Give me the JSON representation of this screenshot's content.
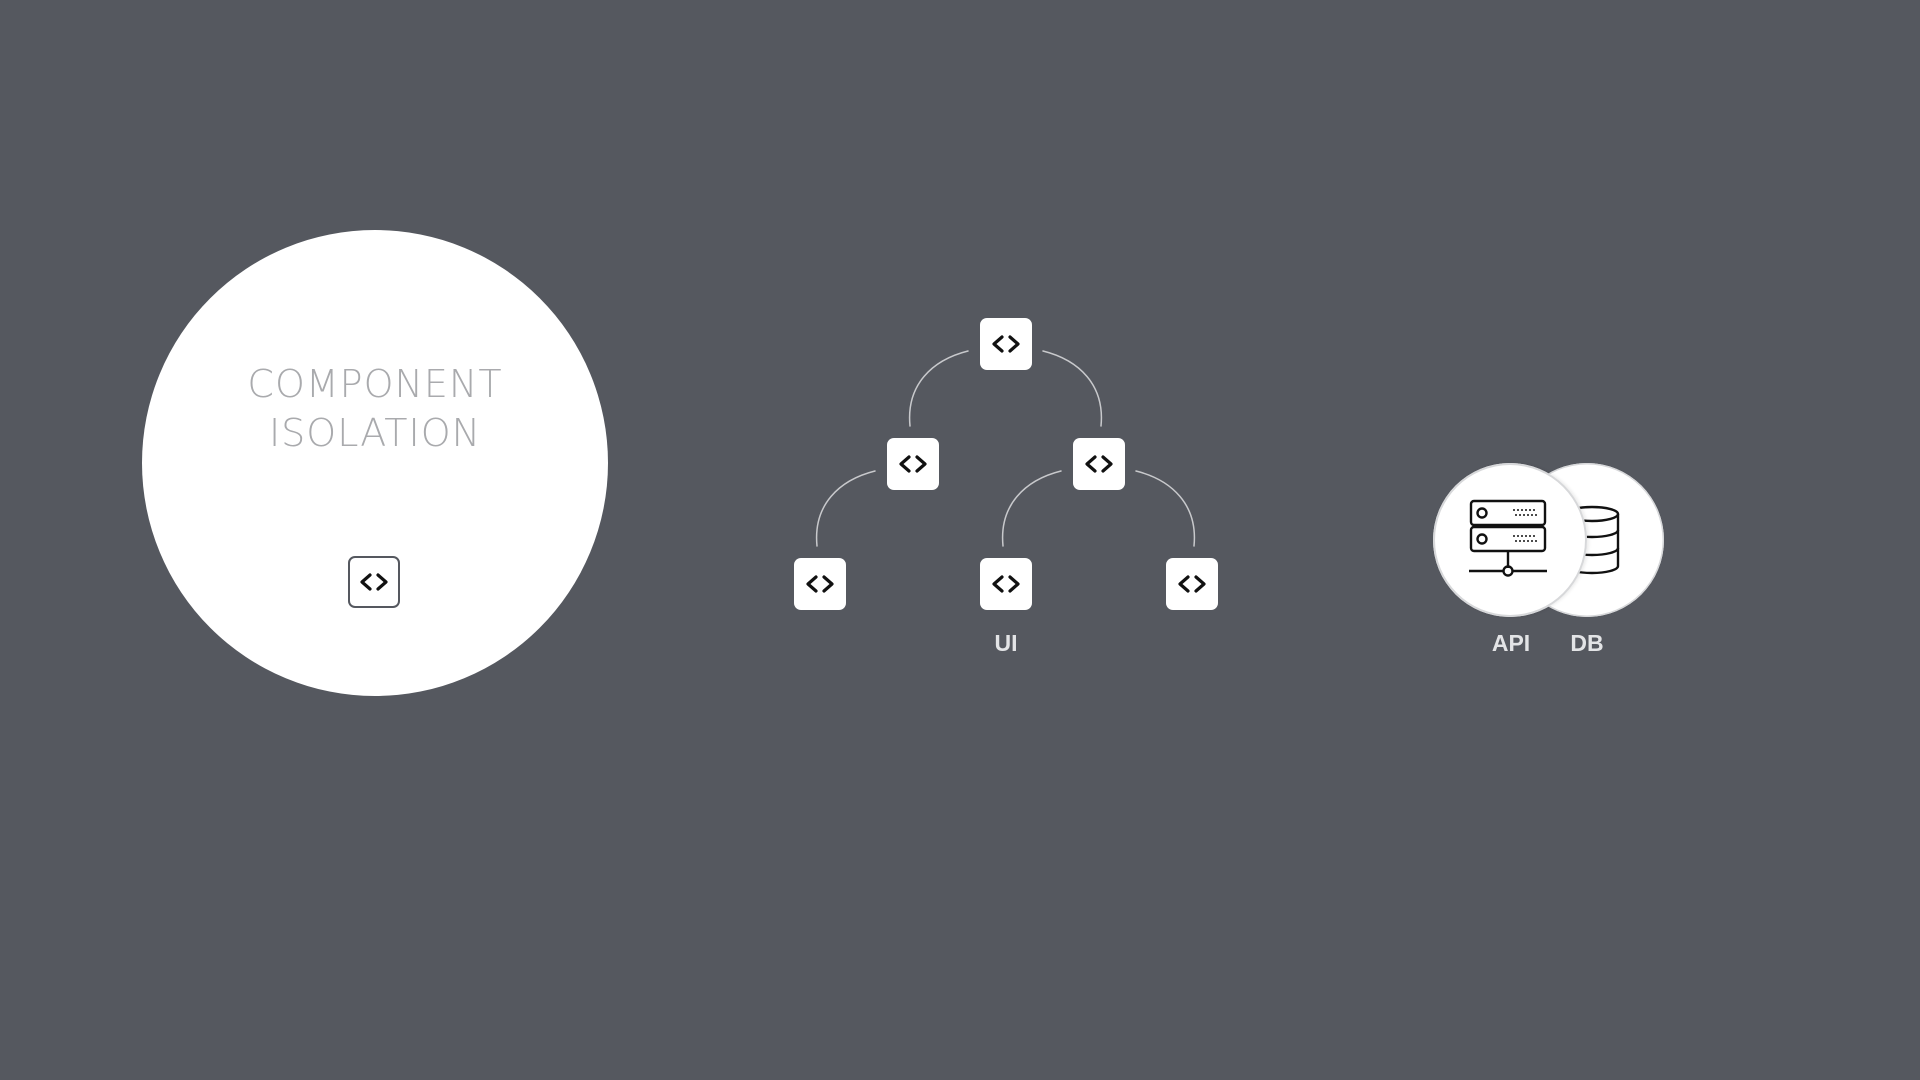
{
  "isolation": {
    "title_line1": "COMPONENT",
    "title_line2": "ISOLATION",
    "component_icon": "code-brackets-icon"
  },
  "tree": {
    "label": "UI",
    "node_icon": "code-brackets-icon",
    "levels": [
      [
        "root"
      ],
      [
        "child-left",
        "child-right"
      ],
      [
        "leaf-1",
        "leaf-2",
        "leaf-3"
      ]
    ]
  },
  "backend": {
    "api_label": "API",
    "db_label": "DB",
    "api_icon": "server-icon",
    "db_icon": "database-icon"
  },
  "colors": {
    "background": "#55585f",
    "node": "#ffffff",
    "title_text": "#a9aaad",
    "label_text": "#e3e4e6",
    "connector": "#c8c9cc"
  }
}
